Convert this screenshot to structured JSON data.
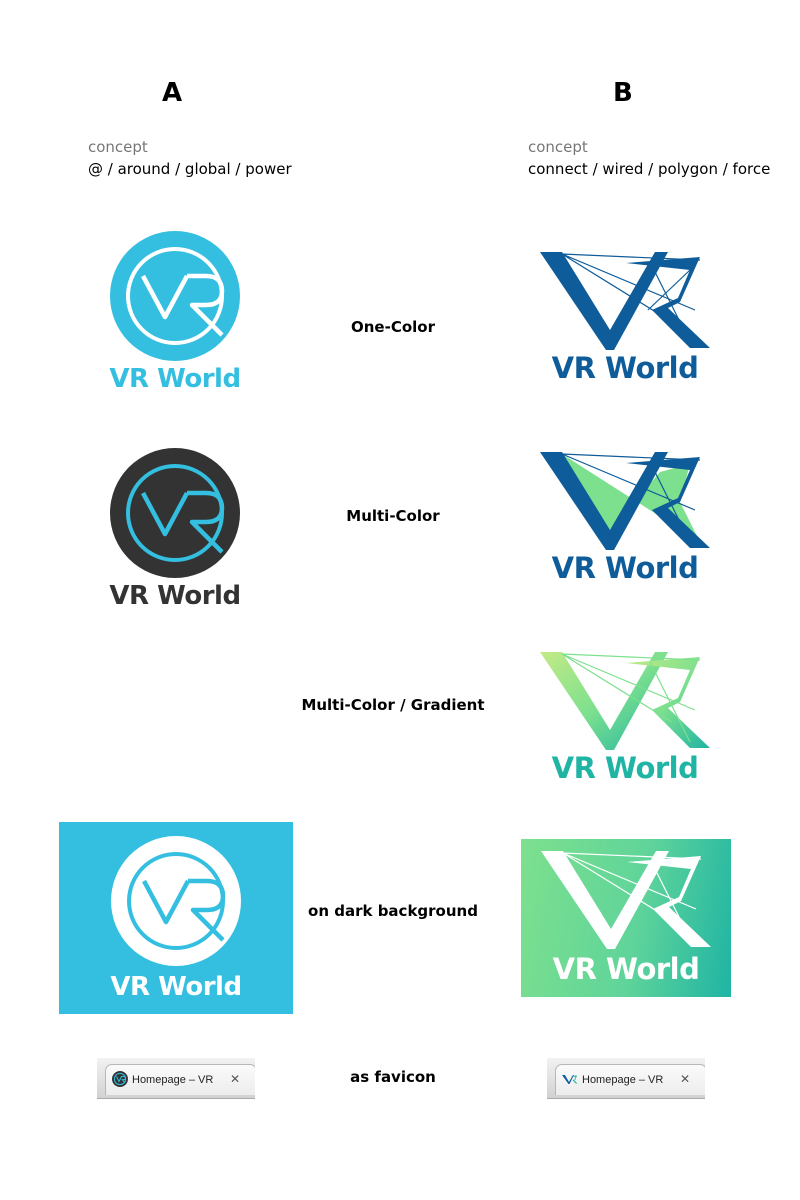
{
  "columns": {
    "a": {
      "letter": "A",
      "concept_label": "concept",
      "concept_words": "@ / around / global / power"
    },
    "b": {
      "letter": "B",
      "concept_label": "concept",
      "concept_words": "connect / wired / polygon / force"
    }
  },
  "rows": {
    "one_color": "One-Color",
    "multi_color": "Multi-Color",
    "gradient": "Multi-Color / Gradient",
    "dark_bg": "on dark background",
    "favicon": "as favicon"
  },
  "logo": {
    "wordmark": "VR World",
    "monogram": "VR"
  },
  "favicon_tab": {
    "title": "Homepage – VR",
    "close": "✕"
  },
  "colors": {
    "cyan": "#34bfe0",
    "charcoal": "#333333",
    "navy": "#0e5c99",
    "mint": "#7de08e",
    "teal": "#1fb4a4",
    "white": "#ffffff"
  }
}
